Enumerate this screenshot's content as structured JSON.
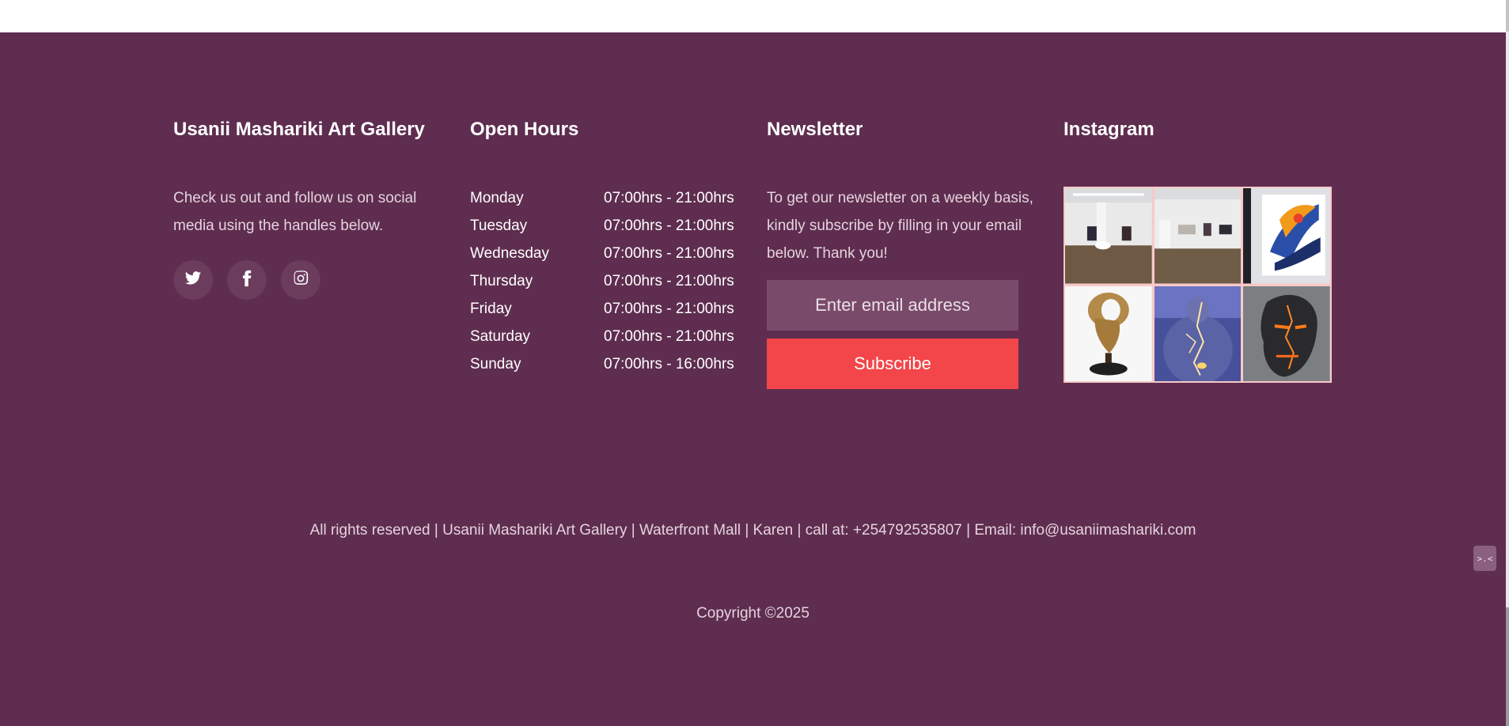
{
  "about": {
    "title": "Usanii Mashariki Art Gallery",
    "text": "Check us out and follow us on social media using the handles below.",
    "social": [
      "twitter-icon",
      "facebook-icon",
      "instagram-icon"
    ]
  },
  "hours": {
    "title": "Open Hours",
    "rows": [
      {
        "day": "Monday",
        "time": "07:00hrs - 21:00hrs"
      },
      {
        "day": "Tuesday",
        "time": "07:00hrs - 21:00hrs"
      },
      {
        "day": "Wednesday",
        "time": "07:00hrs - 21:00hrs"
      },
      {
        "day": "Thursday",
        "time": "07:00hrs - 21:00hrs"
      },
      {
        "day": "Friday",
        "time": "07:00hrs - 21:00hrs"
      },
      {
        "day": "Saturday",
        "time": "07:00hrs - 21:00hrs"
      },
      {
        "day": "Sunday",
        "time": "07:00hrs - 16:00hrs"
      }
    ]
  },
  "newsletter": {
    "title": "Newsletter",
    "text": "To get our newsletter on a weekly basis, kindly subscribe by filling in your email below. Thank you!",
    "placeholder": "Enter email address",
    "button": "Subscribe"
  },
  "instagram": {
    "title": "Instagram"
  },
  "footer": {
    "legal": "All rights reserved | Usanii Mashariki Art Gallery | Waterfront Mall | Karen | call at: +254792535807 | Email: info@usaniimashariki.com",
    "copyright": "Copyright ©2025"
  },
  "chat": {
    "label": ">.<"
  },
  "colors": {
    "background": "#5e2d4f",
    "accent": "#f2464a",
    "input": "#7a4a6a"
  }
}
